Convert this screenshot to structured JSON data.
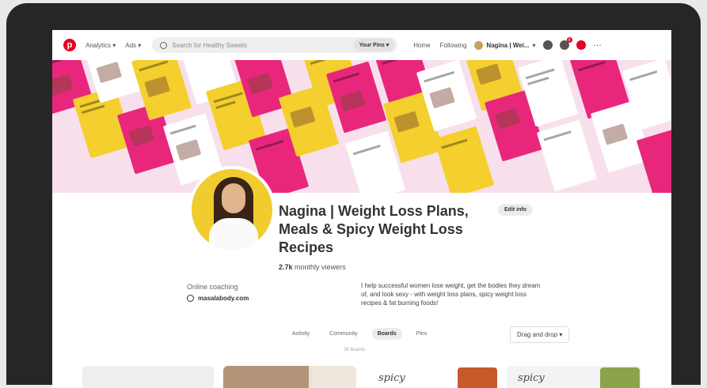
{
  "nav": {
    "logo_letter": "p",
    "items": [
      "Analytics ▾",
      "Ads ▾"
    ],
    "search_placeholder": "Search for Healthy Sweets",
    "search_scope": "Your Pins ▾",
    "home": "Home",
    "following": "Following",
    "username": "Nagina | Wei...",
    "notification_count": "9",
    "more": "···"
  },
  "profile": {
    "name": "Nagina | Weight Loss Plans, Meals & Spicy Weight Loss Recipes",
    "viewers_count": "2.7k",
    "viewers_label": "monthly viewers",
    "edit_label": "Edit info",
    "category": "Online coaching",
    "website": "masalabody.com",
    "bio": "I help successful women lose weight, get the bodies they dream of, and look sexy - with weight loss plans, spicy weight loss recipes & fat burning foods!"
  },
  "tabs": [
    "Activity",
    "Community",
    "Boards",
    "Pins"
  ],
  "active_tab": "Boards",
  "sort_label": "Drag and drop ▾",
  "boards_count": "36 Boards",
  "boards": [
    {
      "script": ""
    },
    {
      "script": ""
    },
    {
      "script": "spicy"
    },
    {
      "script": "spicy"
    }
  ],
  "colors": {
    "brand_red": "#e60023",
    "banner_pink": "#e8277c",
    "banner_yellow": "#f4cf2d"
  }
}
